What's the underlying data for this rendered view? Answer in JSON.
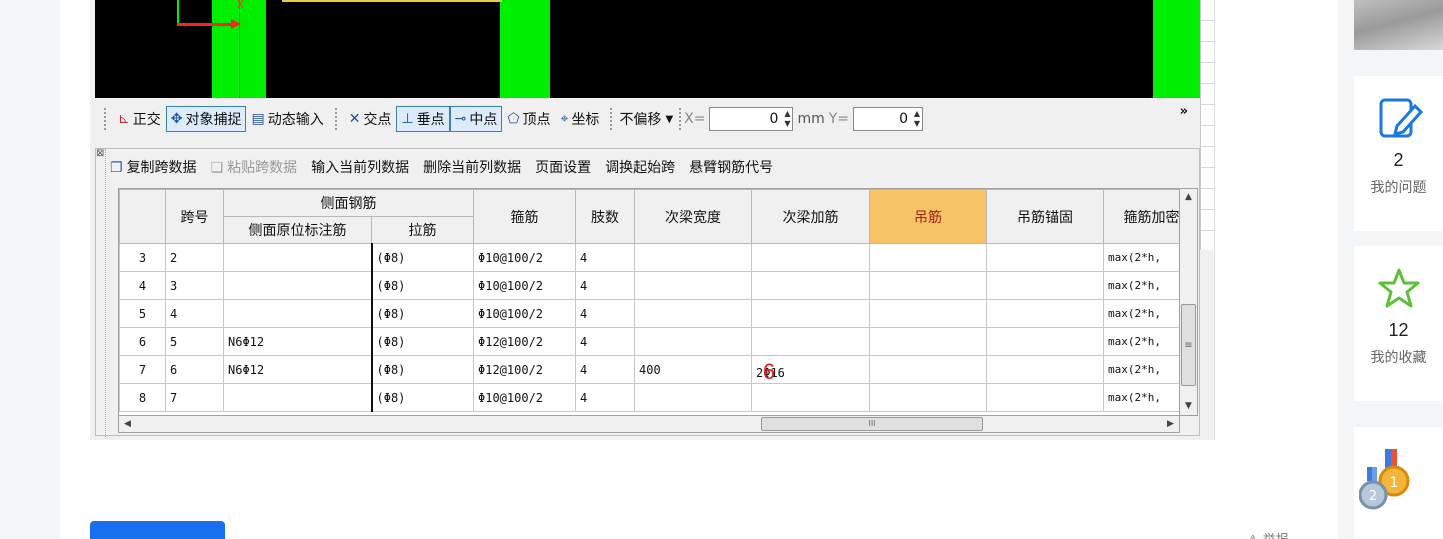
{
  "colors": {
    "accent": "#1a6ff0",
    "canvas": "#000000",
    "beam": "#00ee00",
    "highlight_header": "#f6c365",
    "marker": "#e02020"
  },
  "canvas": {
    "axis_label": "X"
  },
  "snap_toolbar": {
    "items": [
      {
        "label": "正交",
        "icon": "ortho-icon",
        "active": false
      },
      {
        "label": "对象捕捉",
        "icon": "object-snap-icon",
        "active": true
      },
      {
        "label": "动态输入",
        "icon": "dynamic-input-icon",
        "active": false
      },
      {
        "label": "交点",
        "icon": "intersection-icon",
        "active": false
      },
      {
        "label": "垂点",
        "icon": "perpendicular-icon",
        "active": true
      },
      {
        "label": "中点",
        "icon": "midpoint-icon",
        "active": true
      },
      {
        "label": "顶点",
        "icon": "vertex-icon",
        "active": false
      },
      {
        "label": "坐标",
        "icon": "coordinate-icon",
        "active": false
      }
    ],
    "offset_select": "不偏移",
    "x_label": "X=",
    "x_value": "0",
    "unit": "mm",
    "y_label": "Y=",
    "y_value": "0",
    "more": "»"
  },
  "grid_toolbar": {
    "copy_span": "复制跨数据",
    "paste_span": "粘贴跨数据",
    "input_column": "输入当前列数据",
    "delete_column": "删除当前列数据",
    "page_setup": "页面设置",
    "swap_start": "调换起始跨",
    "cantilever_code": "悬臂钢筋代号"
  },
  "table": {
    "headers": {
      "span_no": "跨号",
      "side_rebar": "侧面钢筋",
      "side_original": "侧面原位标注筋",
      "tie_bar": "拉筋",
      "stirrup": "箍筋",
      "legs": "肢数",
      "sec_beam_width": "次梁宽度",
      "sec_beam_rebar": "次梁加筋",
      "hanger": "吊筋",
      "hanger_anchor": "吊筋锚固",
      "stirrup_dense": "箍筋加密"
    },
    "rows": [
      {
        "row": "3",
        "span": "2",
        "side": "",
        "tie": "(Φ8)",
        "stirrup": "Φ10@100/2",
        "legs": "4",
        "width": "",
        "rebar": "",
        "hanger": "",
        "anchor": "",
        "dense": "max(2*h,"
      },
      {
        "row": "4",
        "span": "3",
        "side": "",
        "tie": "(Φ8)",
        "stirrup": "Φ10@100/2",
        "legs": "4",
        "width": "",
        "rebar": "",
        "hanger": "",
        "anchor": "",
        "dense": "max(2*h,"
      },
      {
        "row": "5",
        "span": "4",
        "side": "",
        "tie": "(Φ8)",
        "stirrup": "Φ10@100/2",
        "legs": "4",
        "width": "",
        "rebar": "",
        "hanger": "",
        "anchor": "",
        "dense": "max(2*h,"
      },
      {
        "row": "6",
        "span": "5",
        "side": "N6Φ12",
        "tie": "(Φ8)",
        "stirrup": "Φ12@100/2",
        "legs": "4",
        "width": "",
        "rebar": "",
        "hanger": "",
        "anchor": "",
        "dense": "max(2*h,"
      },
      {
        "row": "7",
        "span": "6",
        "side": "N6Φ12",
        "tie": "(Φ8)",
        "stirrup": "Φ12@100/2",
        "legs": "4",
        "width": "400",
        "rebar": "2Φ16",
        "hanger": "",
        "anchor": "",
        "dense": "max(2*h,"
      },
      {
        "row": "8",
        "span": "7",
        "side": "",
        "tie": "(Φ8)",
        "stirrup": "Φ10@100/2",
        "legs": "4",
        "width": "",
        "rebar": "",
        "hanger": "",
        "anchor": "",
        "dense": "max(2*h,"
      }
    ],
    "annotation_marker": "6"
  },
  "post_actions": {
    "primary": "",
    "items": [
      "",
      "",
      ""
    ],
    "report": "举报"
  },
  "sidebar": {
    "questions": {
      "count": "2",
      "label": "我的问题"
    },
    "favorites": {
      "count": "12",
      "label": "我的收藏"
    }
  }
}
